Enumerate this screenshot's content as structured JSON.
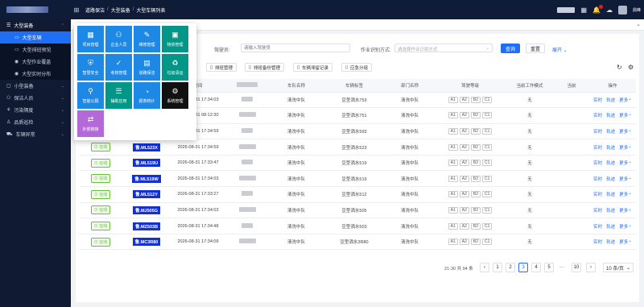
{
  "header": {
    "breadcrumb": [
      "道路保洁",
      "大型装备",
      "大型车辆列表"
    ],
    "user": "鼎峰"
  },
  "sidebar": {
    "items": [
      {
        "label": "大型装备",
        "type": "group",
        "active": true
      },
      {
        "label": "大型车辆",
        "type": "sub",
        "active": true
      },
      {
        "label": "大型排班预览",
        "type": "sub"
      },
      {
        "label": "大型作业覆盖",
        "type": "sub"
      },
      {
        "label": "大型实时分布",
        "type": "sub"
      },
      {
        "label": "小型装备",
        "type": "group"
      },
      {
        "label": "保洁人员",
        "type": "group"
      },
      {
        "label": "污染隔度",
        "type": "group"
      },
      {
        "label": "品质巡检",
        "type": "group"
      },
      {
        "label": "车辆异常",
        "type": "group"
      }
    ]
  },
  "apps": [
    {
      "label": "项目管理",
      "color": "#1e88e5",
      "icon": "▦"
    },
    {
      "label": "企业人员",
      "color": "#1e88e5",
      "icon": "⚇"
    },
    {
      "label": "维修管理",
      "color": "#1e88e5",
      "icon": "✎"
    },
    {
      "label": "物资管理",
      "color": "#009688",
      "icon": "▣"
    },
    {
      "label": "智慧安全",
      "color": "#1e88e5",
      "icon": "⛨"
    },
    {
      "label": "考核管理",
      "color": "#1e88e5",
      "icon": "✓"
    },
    {
      "label": "道路保洁",
      "color": "#1e88e5",
      "icon": "▤"
    },
    {
      "label": "垃圾清运",
      "color": "#009688",
      "icon": "♻"
    },
    {
      "label": "智能公厕",
      "color": "#1e88e5",
      "icon": "⚲"
    },
    {
      "label": "辅助应用",
      "color": "#009688",
      "icon": "☰"
    },
    {
      "label": "报表统计",
      "color": "#1e88e5",
      "icon": "◔"
    },
    {
      "label": "系统管理",
      "color": "#111111",
      "icon": "⚙"
    },
    {
      "label": "外部链接",
      "color": "#b36ad8",
      "icon": "⇄"
    }
  ],
  "filters": {
    "driver_label": "驾驶员:",
    "driver_placeholder": "请输入驾驶员",
    "mode_label": "作业识别方式:",
    "mode_placeholder": "请选择作业识别方式",
    "query": "查询",
    "reset": "重置",
    "expand": "展开"
  },
  "toolbar": {
    "buttons": [
      "排班管理",
      "排班备份管理",
      "车辆滞留记录",
      "应急分组"
    ]
  },
  "table": {
    "headers": [
      "",
      "",
      "时间",
      "",
      "车队名称",
      "车辆标签",
      "部门名称",
      "驾驶等级",
      "当前工作模式",
      "当前",
      "操作"
    ],
    "levels": [
      "A1",
      "A2",
      "B2",
      "C1"
    ],
    "ops": [
      "实时",
      "轨迹",
      "更多"
    ],
    "rows": [
      {
        "status": "",
        "plate": "",
        "time": "2026-08-31 17:34:03",
        "team": "清洗中队",
        "label": "豆型洒水753",
        "dept": "清洗中队",
        "mode": "无"
      },
      {
        "status": "",
        "plate": "",
        "time": "2026-08-31 08:12:30",
        "team": "清洗中队",
        "label": "豆型洒水751",
        "dept": "清洗中队",
        "mode": "无"
      },
      {
        "status": "",
        "plate": "",
        "time": "2026-08-31 17:34:59",
        "team": "清洗中队",
        "label": "豆型洒水593",
        "dept": "清洗中队",
        "mode": "无"
      },
      {
        "status": "在线",
        "plate": "鲁.ML523X",
        "time": "2026-08-31 17:34:59",
        "team": "清洗中队",
        "label": "豆型洒水523",
        "dept": "清洗中队",
        "mode": "无"
      },
      {
        "status": "在线",
        "plate": "鲁.ML519U",
        "time": "2026-08-31 17:33:47",
        "team": "清洗中队",
        "label": "豆型洒水519",
        "dept": "清洗中队",
        "mode": "无"
      },
      {
        "status": "在线",
        "plate": "鲁.ML519W",
        "time": "2026-08-31 17:34:03",
        "team": "清洗中队",
        "label": "豆型洒水519",
        "dept": "清洗中队",
        "mode": "无"
      },
      {
        "status": "在线",
        "plate": "鲁.ML512Y",
        "time": "2026-08-31 17:33:27",
        "team": "清洗中队",
        "label": "豆型洒水512",
        "dept": "清洗中队",
        "mode": "无"
      },
      {
        "status": "在线",
        "plate": "鲁.MJ505G",
        "time": "2026-08-31 17:34:03",
        "team": "清洗中队",
        "label": "豆型洒水505",
        "dept": "清洗中队",
        "mode": "无"
      },
      {
        "status": "在线",
        "plate": "鲁.MZ503B",
        "time": "2026-08-31 17:34:48",
        "team": "清洗中队",
        "label": "豆型洒水503",
        "dept": "清洗中队",
        "mode": "无"
      },
      {
        "status": "在线",
        "plate": "鲁.MC3R80",
        "time": "2026-08-31 17:34:09",
        "team": "清洗中队",
        "label": "豆型洒水3R80",
        "dept": "清洗中队",
        "mode": "无"
      }
    ]
  },
  "pager": {
    "summary": "21-30 共 94 条",
    "pages": [
      "1",
      "2",
      "3",
      "4",
      "5",
      "···",
      "10"
    ],
    "current": "3",
    "size": "10 条/页"
  }
}
